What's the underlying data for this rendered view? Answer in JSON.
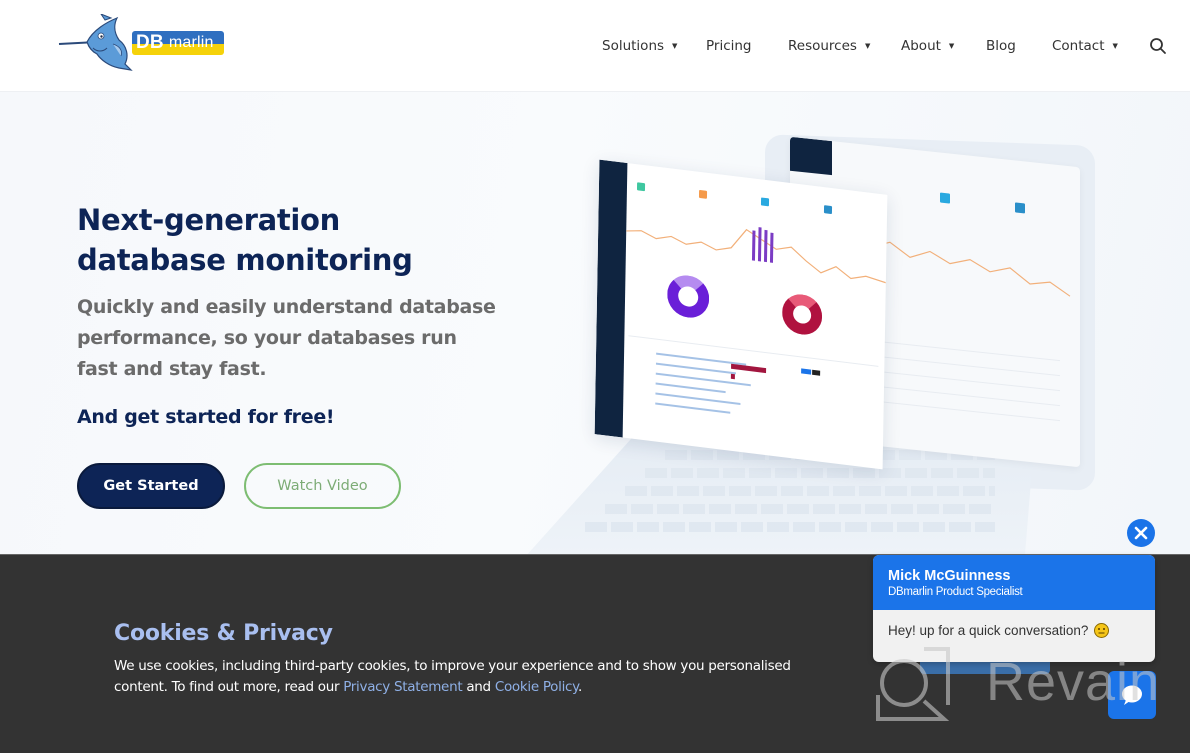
{
  "brand": {
    "name": "DBmarlin",
    "logo_text_bold": "DB",
    "logo_text_rest": "marlin",
    "colors": {
      "navy": "#0d2456",
      "green_outline": "#7dbd72",
      "chat_blue": "#1b74e9",
      "cookie_bg": "#333333",
      "cookie_title": "#a9bff0",
      "cookie_link": "#8fb0e6"
    }
  },
  "nav": {
    "items": [
      {
        "label": "Solutions",
        "has_dropdown": true
      },
      {
        "label": "Pricing",
        "has_dropdown": false
      },
      {
        "label": "Resources",
        "has_dropdown": true
      },
      {
        "label": "About",
        "has_dropdown": true
      },
      {
        "label": "Blog",
        "has_dropdown": false
      },
      {
        "label": "Contact",
        "has_dropdown": true
      }
    ],
    "dropdown_glyph": "▼",
    "search_icon": "search-icon"
  },
  "hero": {
    "title_line1": "Next-generation",
    "title_line2": "database monitoring",
    "subtitle": "Quickly and easily understand database performance, so your databases run fast and stay fast.",
    "cta_text": "And get started for free!",
    "primary_button": "Get Started",
    "secondary_button": "Watch Video",
    "image": "laptop-dashboard-screenshot"
  },
  "cookie_banner": {
    "title": "Cookies & Privacy",
    "text_before": "We use cookies, including third-party cookies, to improve your experience and to show you personalised content. To find out more, read our ",
    "privacy_link": "Privacy Statement",
    "text_middle": " and ",
    "cookie_link": "Cookie Policy",
    "text_after": "."
  },
  "chat": {
    "agent_name": "Mick McGuinness",
    "agent_role": "DBmarlin Product Specialist",
    "message": "Hey! up for a quick conversation?",
    "emoji": "slightly-smiling-face",
    "close_icon": "close-icon",
    "launcher_icon": "chat-bubble-icon"
  },
  "watermark": {
    "text": "Revain"
  }
}
